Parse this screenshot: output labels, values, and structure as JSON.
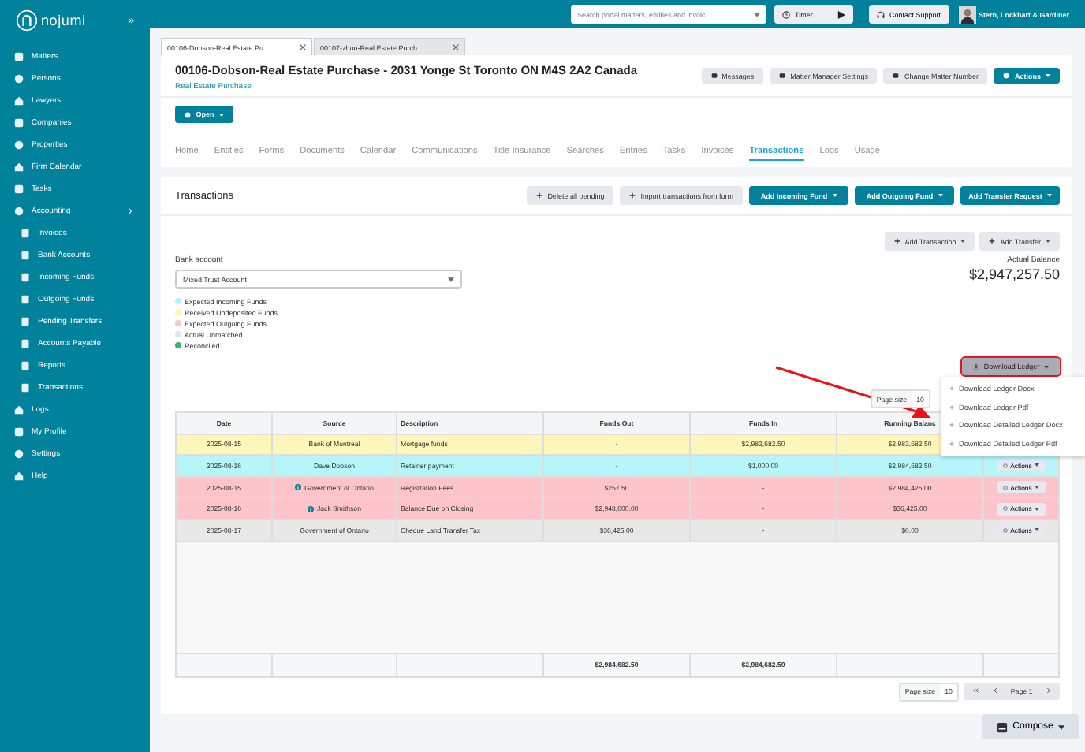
{
  "sidebar": {
    "logo": "nojumi",
    "collapse": "»",
    "items": [
      {
        "label": "Matters"
      },
      {
        "label": "Persons"
      },
      {
        "label": "Lawyers"
      },
      {
        "label": "Companies"
      },
      {
        "label": "Properties"
      },
      {
        "label": "Firm Calendar"
      },
      {
        "label": "Tasks"
      },
      {
        "label": "Accounting",
        "children": [
          {
            "label": "Invoices"
          },
          {
            "label": "Bank Accounts"
          },
          {
            "label": "Incoming Funds"
          },
          {
            "label": "Outgoing Funds"
          },
          {
            "label": "Pending Transfers"
          },
          {
            "label": "Accounts Payable"
          },
          {
            "label": "Reports"
          },
          {
            "label": "Transactions"
          }
        ]
      },
      {
        "label": "Logs"
      },
      {
        "label": "My Profile"
      },
      {
        "label": "Settings"
      },
      {
        "label": "Help"
      }
    ]
  },
  "top_bar": {
    "search": {
      "placeholder": "Search portal matters, entities and invoic"
    },
    "timer": "Timer",
    "support": "Contact Support",
    "user": "Stern, Lockhart & Gardiner"
  },
  "doc_tabs": [
    {
      "label": "00106-Dobson-Real Estate Pu...",
      "selected": true
    },
    {
      "label": "00107-zhou-Real Estate Purch...",
      "selected": false
    }
  ],
  "matter": {
    "title": "00106-Dobson-Real Estate Purchase - 2031 Yonge St Toronto ON M4S 2A2 Canada",
    "subtitle": "Real Estate Purchase",
    "open": "Open",
    "buttons": [
      {
        "label": "Messages",
        "kind": "secondary"
      },
      {
        "label": "Matter Manager Settings",
        "kind": "secondary"
      },
      {
        "label": "Change Matter Number",
        "kind": "secondary"
      },
      {
        "label": "Actions",
        "kind": "primary"
      }
    ]
  },
  "nav_tabs": [
    {
      "label": "Home",
      "selected": false
    },
    {
      "label": "Entities",
      "selected": false
    },
    {
      "label": "Forms",
      "selected": false
    },
    {
      "label": "Documents",
      "selected": false
    },
    {
      "label": "Calendar",
      "selected": false
    },
    {
      "label": "Communications",
      "selected": false
    },
    {
      "label": "Title Insurance",
      "selected": false
    },
    {
      "label": "Searches",
      "selected": false
    },
    {
      "label": "Entries",
      "selected": false
    },
    {
      "label": "Tasks",
      "selected": false
    },
    {
      "label": "Invoices",
      "selected": false
    },
    {
      "label": "Transactions",
      "selected": true
    },
    {
      "label": "Logs",
      "selected": false
    },
    {
      "label": "Usage",
      "selected": false
    }
  ],
  "transactions": {
    "title": "Transactions",
    "header_buttons": [
      {
        "label": "Delete all pending",
        "kind": "secondary"
      },
      {
        "label": "Import transactions from form",
        "kind": "secondary"
      },
      {
        "label": "Add Incoming Fund",
        "kind": "primary"
      },
      {
        "label": "Add Outgoing Fund",
        "kind": "primary"
      },
      {
        "label": "Add Transfer Request",
        "kind": "primary"
      }
    ],
    "add_buttons": [
      "Add Transaction",
      "Add Transfer"
    ],
    "bank_account": {
      "label": "Bank account",
      "value": "Mixed Trust Account"
    },
    "balance": {
      "label": "Actual Balance",
      "value": "$2,947,257.50"
    },
    "legend": [
      {
        "label": "Expected Incoming Funds",
        "color": "#b3f5fb"
      },
      {
        "label": "Received Undeposited Funds",
        "color": "#fdf5b3"
      },
      {
        "label": "Expected Outgoing Funds",
        "color": "#fcc3c8"
      },
      {
        "label": "Actual Unmatched",
        "color": "#e4e5ee"
      },
      {
        "label": "Reconciled",
        "color": "#3bb273"
      }
    ],
    "download": {
      "label": "Download Ledger",
      "highlighted": true,
      "menu": [
        "Download Ledger Docx",
        "Download Ledger Pdf",
        "Download Detailed Ledger Docx",
        "Download Detailed Ledger Pdf"
      ]
    },
    "top_page_size": {
      "label": "Page size",
      "value": "10"
    },
    "table": {
      "columns": [
        "Date",
        "Source",
        "Description",
        "Funds Out",
        "Funds In",
        "Running Balanc"
      ],
      "rows": [
        {
          "date": "2025-08-15",
          "source": "Bank of Montreal",
          "info": false,
          "description": "Mortgage funds",
          "funds_out": "-",
          "funds_in": "$2,983,682.50",
          "balance": "$2,983,682.50",
          "color": "#fdf6b8"
        },
        {
          "date": "2025-08-16",
          "source": "Dave Dobson",
          "info": false,
          "description": "Retainer payment",
          "funds_out": "-",
          "funds_in": "$1,000.00",
          "balance": "$2,984,682.50",
          "actions": "Actions",
          "color": "#b6f6fb"
        },
        {
          "date": "2025-08-15",
          "source": "Government of Ontario",
          "info": true,
          "description": "Registration Fees",
          "funds_out": "$257.50",
          "funds_in": "-",
          "balance": "$2,984,425.00",
          "actions": "Actions",
          "color": "#fdc4c9"
        },
        {
          "date": "2025-08-16",
          "source": "Jack Smithson",
          "info": true,
          "description": "Balance Due on Closing",
          "funds_out": "$2,948,000.00",
          "funds_in": "-",
          "balance": "$36,425.00",
          "actions": "Actions",
          "color": "#fdc4c9"
        },
        {
          "date": "2025-08-17",
          "source": "Government of Ontario",
          "info": false,
          "description": "Cheque Land Transfer Tax",
          "funds_out": "$36,425.00",
          "funds_in": "-",
          "balance": "$0.00",
          "actions": "Actions",
          "color": "#e8e8e8"
        }
      ],
      "totals": {
        "funds_out": "$2,984,682.50",
        "funds_in": "$2,984,682.50"
      }
    },
    "pagination": {
      "page_size_label": "Page size",
      "page_size": "10",
      "page": "Page 1"
    }
  },
  "compose": "Compose"
}
